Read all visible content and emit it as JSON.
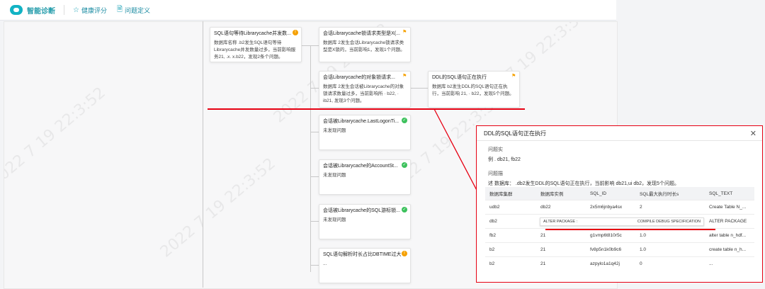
{
  "app": {
    "name": "智能诊断"
  },
  "nav": [
    {
      "icon": "star-icon",
      "glyph": "☆",
      "label": "健康评分"
    },
    {
      "icon": "document-icon",
      "glyph": "🗎",
      "label": "问题定义"
    }
  ],
  "watermark": "2022 7 19 22:3:52",
  "cards": {
    "root": {
      "title": "SQL语句等待Librarycache并发数...",
      "body": "数据库名称  .b2发生SQL语句等待Librarycache并发数量过多，当前影响服务21, .x.  x.b22，发现2条个问题。"
    },
    "c1": {
      "title": "会话Librarycache锁请求类型是X(...",
      "body": "数据库      2发生会话Librarycache锁请求类型是X锁的，当前影响1，发现1个问题。"
    },
    "c2": {
      "title": "会话Librarycache的对象锁请求...",
      "body": "数据库      2发生会话被Librarycache的对象锁请求数量过多，当前影响所 ·  b22,      · ib21, 发现3个问题。"
    },
    "c3": {
      "title": "DDL的SQL语句正在执行",
      "body": "数据库     b2发生DDL的SQL语句正在执行，当前影响     21,  ·  b22，发现5个问题。"
    },
    "c4": {
      "title": "会话被Librarycache.LastLogonTi...",
      "body": "未发现问题"
    },
    "c5": {
      "title": "会话被Librarycache的AccountSt...",
      "body": "未发现问题"
    },
    "c6": {
      "title": "会话被Librarycache的SQL游标锁...",
      "body": "未发现问题"
    },
    "c7": {
      "title": "SQL语句解析时长占比DBTIME过大",
      "body": "..."
    }
  },
  "panel": {
    "title": "DDL的SQL语句正在执行",
    "close": "✕",
    "problem_instance_label": "问题实",
    "problem_instance_value": "例     . db21,     fb22",
    "problem_desc_label": "问题描",
    "problem_desc_value": "述  数据库：   .db2发生DDL的SQL语句正在执行，当前影响   db21,ui  db2，发现5个问题。",
    "columns": [
      "数据库集群",
      "数据库实例",
      "SQL_ID",
      "SQL最大执行时长s",
      "SQL_TEXT"
    ],
    "rows": [
      [
        "  udb2",
        "db22",
        "2x5m6jnbya4sx",
        "2",
        "Create Table N_..."
      ],
      [
        "  db2",
        "6",
        "",
        "",
        "ALTER PACKAGE"
      ],
      [
        "fb2",
        "21",
        "g1vmp6t810r5c",
        "1.0",
        "alter table n_hdf..."
      ],
      [
        "b2",
        "21",
        "fv8p5n1k0b9c6",
        "1.0",
        "create table n_h..."
      ],
      [
        "b2",
        "21",
        "azpylo1a1q42j",
        "0",
        "..."
      ]
    ],
    "popup_left": "ALTER PACKAGE :        ",
    "popup_right": "COMPILE DEBUG SPECIFICATION"
  }
}
